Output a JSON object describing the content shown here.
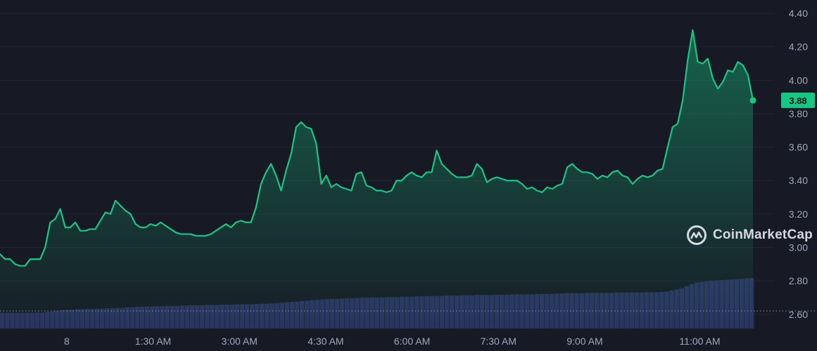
{
  "chart_data": {
    "type": "area",
    "yticks": [
      "4.40",
      "4.20",
      "4.00",
      "3.80",
      "3.60",
      "3.40",
      "3.20",
      "3.00",
      "2.80",
      "2.60"
    ],
    "ylim": [
      2.515,
      4.48
    ],
    "xticks": [
      "8",
      "1:30 AM",
      "3:00 AM",
      "4:30 AM",
      "6:00 AM",
      "7:30 AM",
      "9:00 AM",
      "11:00 AM"
    ],
    "xtick_hours": [
      0,
      1.5,
      3.0,
      4.5,
      6.0,
      7.5,
      9.0,
      11.0
    ],
    "x_range_hours": [
      -1.16,
      12.29
    ],
    "current_price": "3.88",
    "reference_line": 2.62,
    "series": [
      {
        "values": [
          2.96,
          2.93,
          2.93,
          2.9,
          2.89,
          2.89,
          2.93,
          2.93,
          2.93,
          3.0,
          3.15,
          3.17,
          3.23,
          3.12,
          3.12,
          3.15,
          3.1,
          3.1,
          3.11,
          3.11,
          3.16,
          3.21,
          3.2,
          3.28,
          3.25,
          3.22,
          3.2,
          3.14,
          3.12,
          3.12,
          3.14,
          3.13,
          3.15,
          3.13,
          3.11,
          3.09,
          3.08,
          3.08,
          3.08,
          3.07,
          3.07,
          3.07,
          3.08,
          3.1,
          3.12,
          3.14,
          3.12,
          3.15,
          3.16,
          3.15,
          3.15,
          3.24,
          3.38,
          3.45,
          3.5,
          3.43,
          3.34,
          3.46,
          3.56,
          3.72,
          3.75,
          3.72,
          3.71,
          3.62,
          3.38,
          3.43,
          3.36,
          3.38,
          3.36,
          3.35,
          3.34,
          3.44,
          3.45,
          3.37,
          3.36,
          3.34,
          3.34,
          3.33,
          3.34,
          3.4,
          3.4,
          3.43,
          3.45,
          3.43,
          3.42,
          3.45,
          3.45,
          3.58,
          3.5,
          3.47,
          3.44,
          3.42,
          3.42,
          3.42,
          3.43,
          3.5,
          3.47,
          3.39,
          3.41,
          3.42,
          3.41,
          3.4,
          3.4,
          3.4,
          3.38,
          3.35,
          3.36,
          3.34,
          3.33,
          3.36,
          3.35,
          3.37,
          3.38,
          3.48,
          3.5,
          3.47,
          3.45,
          3.45,
          3.44,
          3.41,
          3.43,
          3.42,
          3.45,
          3.46,
          3.43,
          3.42,
          3.38,
          3.41,
          3.43,
          3.42,
          3.43,
          3.46,
          3.47,
          3.6,
          3.72,
          3.74,
          3.88,
          4.12,
          4.3,
          4.11,
          4.1,
          4.13,
          4.01,
          3.95,
          3.99,
          4.06,
          4.05,
          4.11,
          4.09,
          4.03,
          3.88
        ]
      },
      {
        "type": "bar",
        "values": [
          0.52,
          0.52,
          0.52,
          0.52,
          0.52,
          0.52,
          0.52,
          0.53,
          0.53,
          0.55,
          0.56,
          0.59,
          0.61,
          0.62,
          0.62,
          0.64,
          0.64,
          0.65,
          0.65,
          0.66,
          0.66,
          0.67,
          0.67,
          0.68,
          0.68,
          0.7,
          0.7,
          0.72,
          0.72,
          0.73,
          0.73,
          0.74,
          0.74,
          0.75,
          0.75,
          0.75,
          0.76,
          0.76,
          0.77,
          0.77,
          0.77,
          0.78,
          0.78,
          0.78,
          0.79,
          0.79,
          0.79,
          0.8,
          0.8,
          0.8,
          0.8,
          0.81,
          0.82,
          0.82,
          0.83,
          0.84,
          0.86,
          0.87,
          0.88,
          0.89,
          0.91,
          0.92,
          0.94,
          0.95,
          0.96,
          0.97,
          0.98,
          0.98,
          0.99,
          1.0,
          1.0,
          1.01,
          1.02,
          1.02,
          1.03,
          1.03,
          1.03,
          1.04,
          1.04,
          1.04,
          1.05,
          1.05,
          1.05,
          1.06,
          1.06,
          1.07,
          1.07,
          1.08,
          1.08,
          1.09,
          1.09,
          1.09,
          1.1,
          1.1,
          1.1,
          1.11,
          1.11,
          1.11,
          1.11,
          1.12,
          1.12,
          1.12,
          1.13,
          1.13,
          1.13,
          1.13,
          1.13,
          1.14,
          1.14,
          1.14,
          1.14,
          1.15,
          1.16,
          1.17,
          1.17,
          1.17,
          1.17,
          1.18,
          1.18,
          1.18,
          1.18,
          1.18,
          1.18,
          1.19,
          1.19,
          1.19,
          1.19,
          1.19,
          1.19,
          1.2,
          1.2,
          1.2,
          1.21,
          1.23,
          1.26,
          1.29,
          1.33,
          1.4,
          1.47,
          1.52,
          1.54,
          1.56,
          1.58,
          1.59,
          1.6,
          1.61,
          1.62,
          1.63,
          1.64,
          1.66,
          1.67
        ]
      }
    ]
  },
  "watermark": {
    "text": "CoinMarketCap",
    "icon": "coinmarketcap-logo-icon"
  },
  "colors": {
    "background": "#171924",
    "line": "#16c784",
    "volume": "#2b3260",
    "grid": "#222533",
    "axis_text": "#a1a7bb"
  }
}
